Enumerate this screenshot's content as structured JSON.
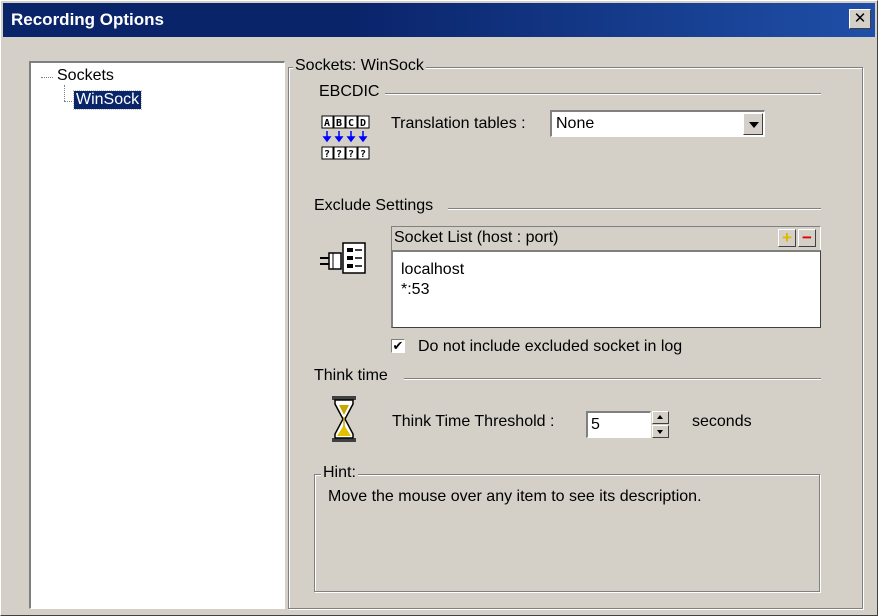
{
  "window": {
    "title": "Recording Options"
  },
  "tree": {
    "items": [
      {
        "label": "Sockets"
      },
      {
        "label": "WinSock"
      }
    ]
  },
  "panel": {
    "group_title": "Sockets: WinSock",
    "ebcdic": {
      "section_title": "EBCDIC",
      "icon_top": "ABCD",
      "icon_bottom": "????",
      "translation_label": "Translation tables :",
      "translation_value": "None"
    },
    "exclude": {
      "section_title": "Exclude Settings",
      "list_header": "Socket List (host : port)",
      "add_label": "+",
      "remove_label": "−",
      "items": [
        "localhost",
        "*:53"
      ],
      "checkbox_checked": true,
      "checkbox_label": "Do not include excluded socket in log"
    },
    "think_time": {
      "section_title": "Think time",
      "threshold_label": "Think Time Threshold :",
      "threshold_value": "5",
      "unit_label": "seconds"
    },
    "hint": {
      "title": "Hint:",
      "text": "Move the mouse over any item to see its description."
    }
  },
  "colors": {
    "titlebar": "#0a246a",
    "face": "#d4d0c8",
    "selection": "#0a246a",
    "add_button": "#ffd400",
    "remove_button": "#e00000"
  }
}
